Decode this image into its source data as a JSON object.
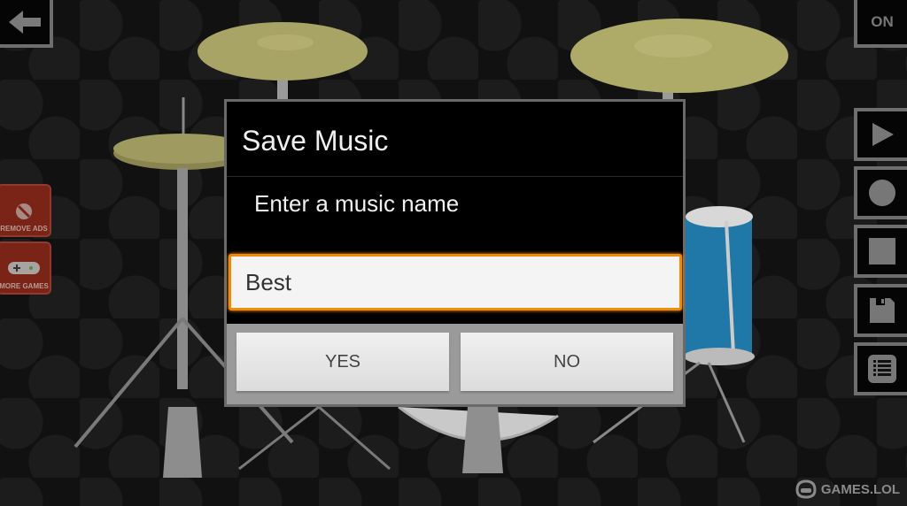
{
  "top_bar": {
    "back_icon": "arrow-left-icon",
    "power_toggle_label": "ON"
  },
  "promo": {
    "remove_ads_label": "REMOVE ADS",
    "more_games_label": "MORE GAMES"
  },
  "controls": [
    {
      "name": "play",
      "icon": "play-icon"
    },
    {
      "name": "record",
      "icon": "record-icon"
    },
    {
      "name": "stop",
      "icon": "stop-icon"
    },
    {
      "name": "save",
      "icon": "floppy-disk-icon"
    },
    {
      "name": "list",
      "icon": "list-icon"
    }
  ],
  "dialog": {
    "title": "Save Music",
    "message": "Enter a music name",
    "input_value": "Best",
    "yes_label": "YES",
    "no_label": "NO",
    "accent_color": "#f08a0a"
  },
  "watermark": "GAMES.LOL"
}
